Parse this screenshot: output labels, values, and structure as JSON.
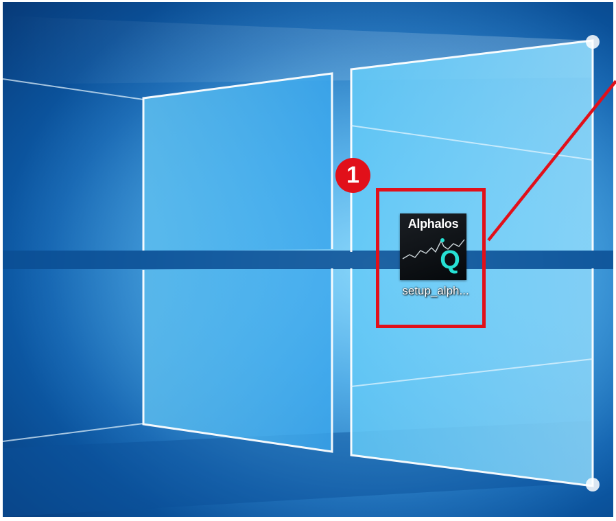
{
  "desktop": {
    "icons": [
      {
        "label": "setup_alph...",
        "brand_text": "Alphalos",
        "glyph": "Q",
        "icon_name": "alphalosq-installer-icon"
      }
    ]
  },
  "annotation": {
    "step_number": "1",
    "color": "#e1101a"
  },
  "colors": {
    "wallpaper_blue": "#1f83d3",
    "icon_teal": "#26e1d4"
  }
}
